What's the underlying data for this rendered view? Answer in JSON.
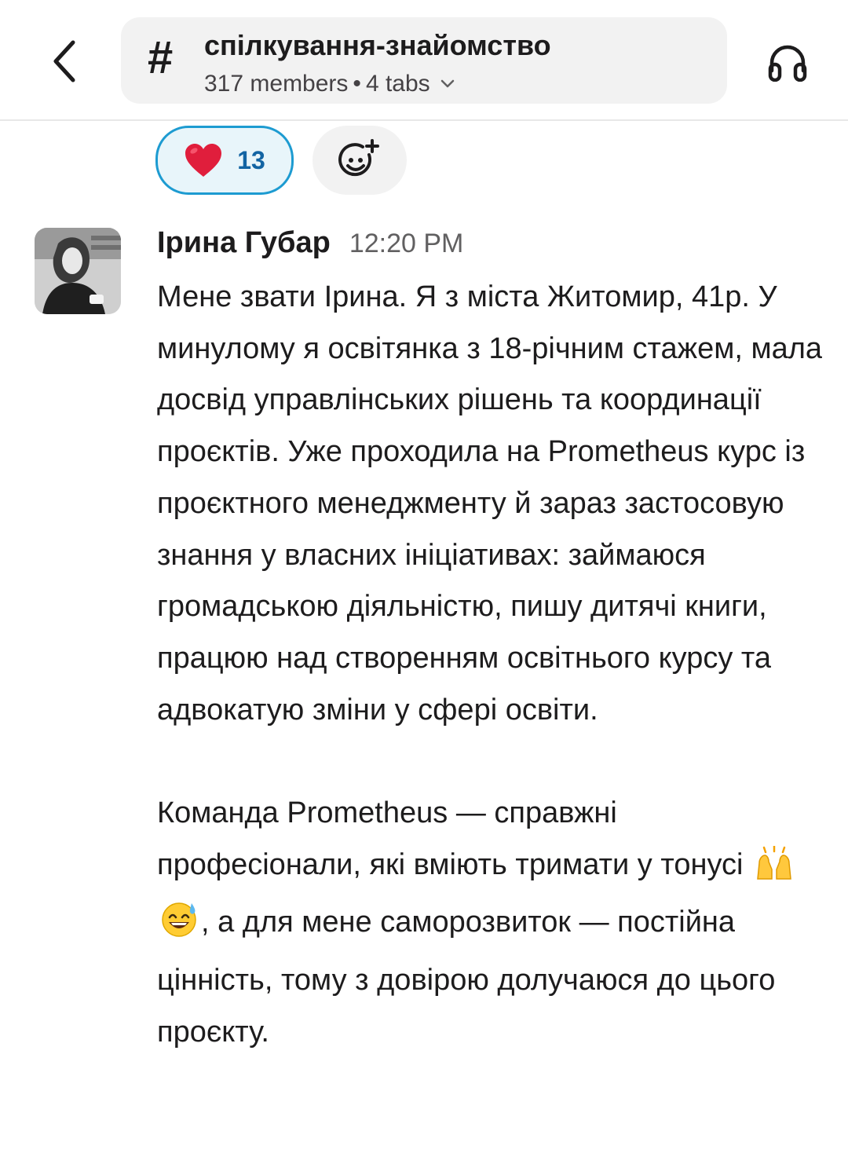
{
  "header": {
    "channel_hash": "#",
    "channel_name": "спілкування-знайомство",
    "members": "317 members",
    "dot": "•",
    "tabs": "4 tabs"
  },
  "reactions": [
    {
      "emoji": "heart",
      "count": "13"
    }
  ],
  "message": {
    "author": "Ірина Губар",
    "time": "12:20 PM",
    "paragraph1": "Мене звати Ірина. Я з міста Житомир, 41р. У минулому я освітянка з 18-річним стажем, мала досвід управлінських рішень та координації проєктів. Уже проходила на Prometheus курс із проєктного менеджменту й зараз застосовую знання у власних ініціативах: займаюся громадською діяльністю, пишу дитячі книги, працюю над створенням освітнього курсу та адвокатую зміни у сфері освіти.",
    "paragraph2_before": "Команда Prometheus — справжні професіонали, які вміють тримати у тонусі",
    "paragraph2_after": ", а для мене саморозвиток — постійна цінність, тому з довірою долучаюся до цього проєкту."
  },
  "icons": {
    "back": "chevron-left-icon",
    "huddle": "headphones-icon",
    "heart": "heart-emoji",
    "add_reaction": "add-reaction-icon",
    "raised_hands": "raised-hands-emoji",
    "sweat_smile": "sweat-smile-emoji"
  },
  "colors": {
    "reaction_border": "#1d9bd1",
    "reaction_bg": "#e8f5fa",
    "reaction_count": "#1264a3",
    "heart": "#e01e3c"
  }
}
